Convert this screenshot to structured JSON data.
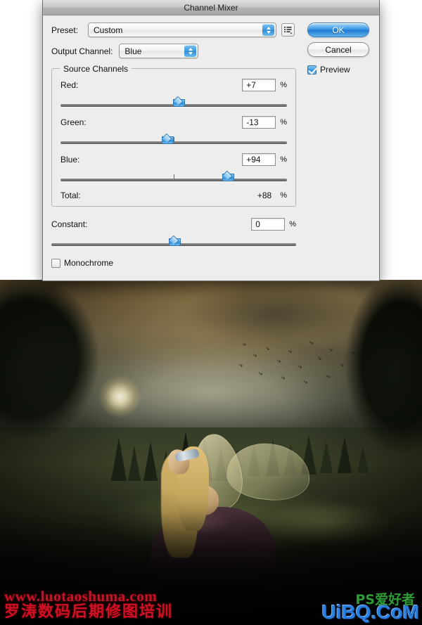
{
  "dialog": {
    "title": "Channel Mixer",
    "preset": {
      "label": "Preset:",
      "value": "Custom",
      "menu_icon": "preset-options-icon"
    },
    "output_channel": {
      "label": "Output Channel:",
      "value": "Blue"
    },
    "buttons": {
      "ok": "OK",
      "cancel": "Cancel"
    },
    "preview": {
      "label": "Preview",
      "checked": true
    },
    "source_channels": {
      "title": "Source Channels",
      "channels": [
        {
          "label": "Red:",
          "value": "+7",
          "unit": "%",
          "pos_pct": 51.8
        },
        {
          "label": "Green:",
          "value": "-13",
          "unit": "%",
          "pos_pct": 46.8,
          "tick_pct": 50
        },
        {
          "label": "Blue:",
          "value": "+94",
          "unit": "%",
          "pos_pct": 73.5,
          "tick_pct": 50
        }
      ],
      "total": {
        "label": "Total:",
        "value": "+88",
        "unit": "%"
      }
    },
    "constant": {
      "label": "Constant:",
      "value": "0",
      "unit": "%",
      "pos_pct": 50
    },
    "monochrome": {
      "label": "Monochrome",
      "checked": false
    }
  },
  "photo": {
    "description": "Fairy in misty forest at dusk",
    "birds_glyph": "∴"
  },
  "watermarks": {
    "left_url": "www.luotaoshuma.com",
    "left_cn": "罗涛数码后期修图培训",
    "right_ps": "PS爱好者",
    "right_site": "UiBQ.CoM"
  },
  "colors": {
    "accent_blue": "#2f8fe0",
    "dialog_bg": "#ededed",
    "watermark_red": "#cf1026",
    "watermark_blue": "#2b7fe0",
    "watermark_green": "#2f9c36"
  }
}
